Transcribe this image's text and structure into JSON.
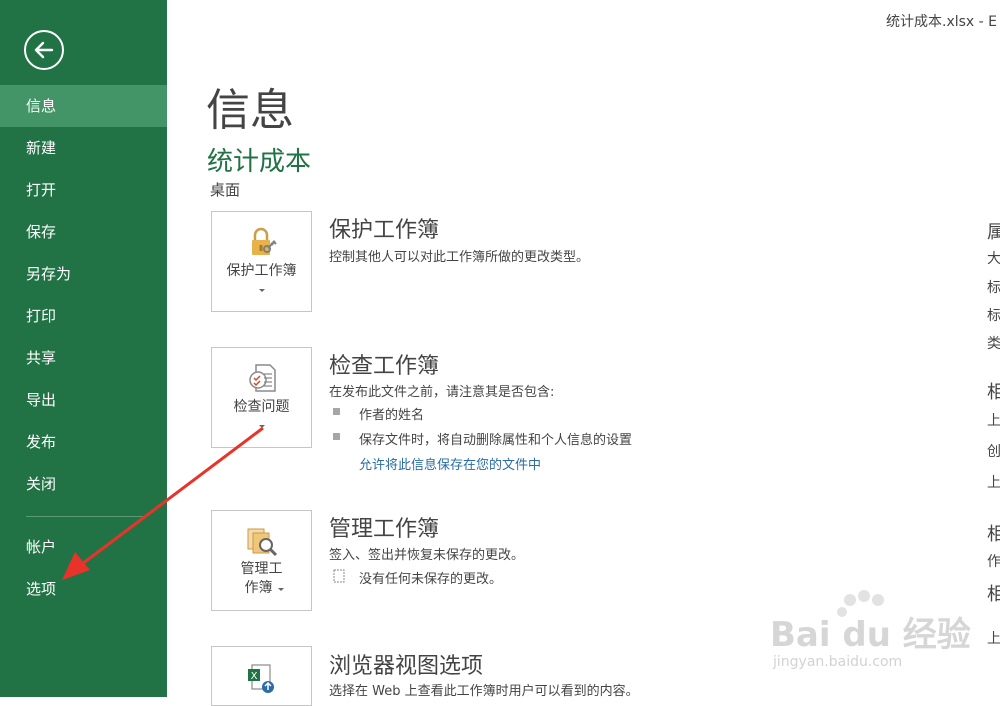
{
  "window": {
    "title": "统计成本.xlsx - E"
  },
  "sidebar": {
    "items": [
      {
        "label": "信息"
      },
      {
        "label": "新建"
      },
      {
        "label": "打开"
      },
      {
        "label": "保存"
      },
      {
        "label": "另存为"
      },
      {
        "label": "打印"
      },
      {
        "label": "共享"
      },
      {
        "label": "导出"
      },
      {
        "label": "发布"
      },
      {
        "label": "关闭"
      },
      {
        "label": "帐户"
      },
      {
        "label": "选项"
      }
    ]
  },
  "main": {
    "page_title": "信息",
    "doc_name": "统计成本",
    "doc_path": "桌面",
    "sections": [
      {
        "button_label": "保护工作簿",
        "title": "保护工作簿",
        "desc": "控制其他人可以对此工作簿所做的更改类型。"
      },
      {
        "button_label": "检查问题",
        "title": "检查工作簿",
        "desc": "在发布此文件之前，请注意其是否包含:",
        "bullets": [
          "作者的姓名",
          "保存文件时，将自动删除属性和个人信息的设置"
        ],
        "link": "允许将此信息保存在您的文件中"
      },
      {
        "button_label_line1": "管理工",
        "button_label_line2": "作簿",
        "title": "管理工作簿",
        "desc": "签入、签出并恢复未保存的更改。",
        "status": "没有任何未保存的更改。"
      },
      {
        "title": "浏览器视图选项",
        "desc": "选择在 Web 上查看此工作簿时用户可以看到的内容。"
      }
    ]
  },
  "properties": {
    "items": [
      "属",
      "大",
      "标",
      "标",
      "类",
      "相",
      "上",
      "创",
      "上",
      "相",
      "作",
      "相",
      "上"
    ]
  },
  "watermark": {
    "text": "Bai du 经验",
    "sub": "jingyan.baidu.com"
  },
  "colors": {
    "accent": "#217346",
    "active": "#439467",
    "link": "#2a6ca5",
    "annotation": "#e8332a"
  }
}
